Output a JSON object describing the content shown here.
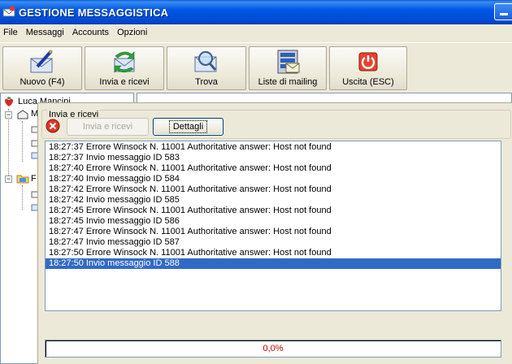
{
  "window": {
    "title": "GESTIONE MESSAGGISTICA"
  },
  "menu": [
    "File",
    "Messaggi",
    "Accounts",
    "Opzioni"
  ],
  "toolbar": [
    {
      "label": "Nuovo (F4)",
      "icon": "pen-envelope-icon"
    },
    {
      "label": "Invia e ricevi",
      "icon": "send-receive-icon"
    },
    {
      "label": "Trova",
      "icon": "magnifier-envelope-icon"
    },
    {
      "label": "Liste di mailing",
      "icon": "mailing-list-icon"
    },
    {
      "label": "Uscita (ESC)",
      "icon": "exit-power-icon"
    }
  ],
  "tree": {
    "root_label": "Luca Mancini",
    "child1_initial": "M",
    "child2_initial": "F"
  },
  "dialog": {
    "title": "Invia e ricevi",
    "send_receive_label": "Invia e ricevi",
    "details_label": "Dettagli",
    "log": [
      "18:27:37 Errore Winsock N. 11001 Authoritative answer: Host not found",
      "18:27:37 Invio messaggio ID 583",
      "18:27:40 Errore Winsock N. 11001 Authoritative answer: Host not found",
      "18:27:40 Invio messaggio ID 584",
      "18:27:42 Errore Winsock N. 11001 Authoritative answer: Host not found",
      "18:27:42 Invio messaggio ID 585",
      "18:27:45 Errore Winsock N. 11001 Authoritative answer: Host not found",
      "18:27:45 Invio messaggio ID 586",
      "18:27:47 Errore Winsock N. 11001 Authoritative answer: Host not found",
      "18:27:47 Invio messaggio ID 587",
      "18:27:50 Errore Winsock N. 11001 Authoritative answer: Host not found",
      "18:27:50 Invio messaggio ID 588"
    ],
    "selected_index": 11,
    "progress_text": "0,0%",
    "progress_value": 0
  },
  "colors": {
    "titlebar": "#0054e3",
    "selection": "#316ac5",
    "progress_text": "#c00000"
  }
}
